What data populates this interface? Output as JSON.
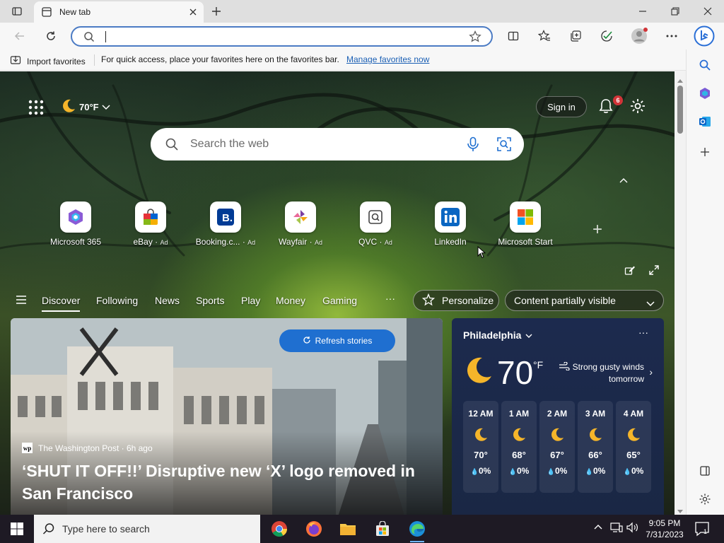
{
  "browser": {
    "tab_title": "New tab",
    "address_value": "",
    "favorites_bar": {
      "import_label": "Import favorites",
      "message": "For quick access, place your favorites here on the favorites bar.",
      "link": "Manage favorites now"
    }
  },
  "newtab": {
    "weather_mini": "70°F",
    "sign_in": "Sign in",
    "notification_count": "6",
    "search_placeholder": "Search the web",
    "quick_links": [
      {
        "label": "Microsoft 365",
        "ad": ""
      },
      {
        "label": "eBay",
        "ad": "Ad"
      },
      {
        "label": "Booking.c...",
        "ad": "Ad"
      },
      {
        "label": "Wayfair",
        "ad": "Ad"
      },
      {
        "label": "QVC",
        "ad": "Ad"
      },
      {
        "label": "LinkedIn",
        "ad": ""
      },
      {
        "label": "Microsoft Start",
        "ad": ""
      }
    ],
    "nav_tabs": [
      "Discover",
      "Following",
      "News",
      "Sports",
      "Play",
      "Money",
      "Gaming"
    ],
    "nav_more": "···",
    "personalize": "Personalize",
    "content_visibility": "Content partially visible",
    "refresh_stories": "Refresh stories",
    "hero": {
      "source": "The Washington Post · 6h ago",
      "headline": "‘SHUT IT OFF!!’ Disruptive new ‘X’ logo removed in San Francisco"
    },
    "weather": {
      "city": "Philadelphia",
      "temp": "70",
      "unit": "°F",
      "condition": "Strong gusty winds tomorrow",
      "hours": [
        {
          "time": "12 AM",
          "temp": "70°",
          "precip": "0%"
        },
        {
          "time": "1 AM",
          "temp": "68°",
          "precip": "0%"
        },
        {
          "time": "2 AM",
          "temp": "67°",
          "precip": "0%"
        },
        {
          "time": "3 AM",
          "temp": "66°",
          "precip": "0%"
        },
        {
          "time": "4 AM",
          "temp": "65°",
          "precip": "0%"
        }
      ]
    }
  },
  "taskbar": {
    "search_placeholder": "Type here to search",
    "time": "9:05 PM",
    "date": "7/31/2023",
    "notification_count": "1"
  },
  "colors": {
    "accent": "#1f6fd0",
    "link": "#1a5fb4",
    "weather_bg": "#1c2a4e",
    "badge": "#d13438"
  }
}
